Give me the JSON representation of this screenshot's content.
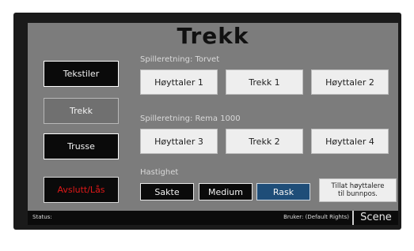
{
  "title": "Trekk",
  "sidebar": {
    "items": [
      {
        "label": "Tekstiler"
      },
      {
        "label": "Trekk"
      },
      {
        "label": "Trusse"
      },
      {
        "label": "Avslutt/Lås"
      }
    ]
  },
  "section1": {
    "label": "Spilleretning: Torvet",
    "buttons": [
      "Høyttaler 1",
      "Trekk 1",
      "Høyttaler 2"
    ]
  },
  "section2": {
    "label": "Spilleretning: Rema 1000",
    "buttons": [
      "Høyttaler 3",
      "Trekk 2",
      "Høyttaler 4"
    ]
  },
  "speed": {
    "label": "Hastighet",
    "options": [
      "Sakte",
      "Medium",
      "Rask"
    ],
    "selected": "Rask"
  },
  "allow_button": {
    "line1": "Tillat høyttalere",
    "line2": "til bunnpos."
  },
  "status_bar": {
    "status_label": "Status:",
    "user_text": "Bruker: (Default Rights)",
    "scene_label": "Scene"
  },
  "colors": {
    "panel": "#7c7c7c",
    "exit_text": "#e01818",
    "speed_active": "#1e4d78"
  }
}
